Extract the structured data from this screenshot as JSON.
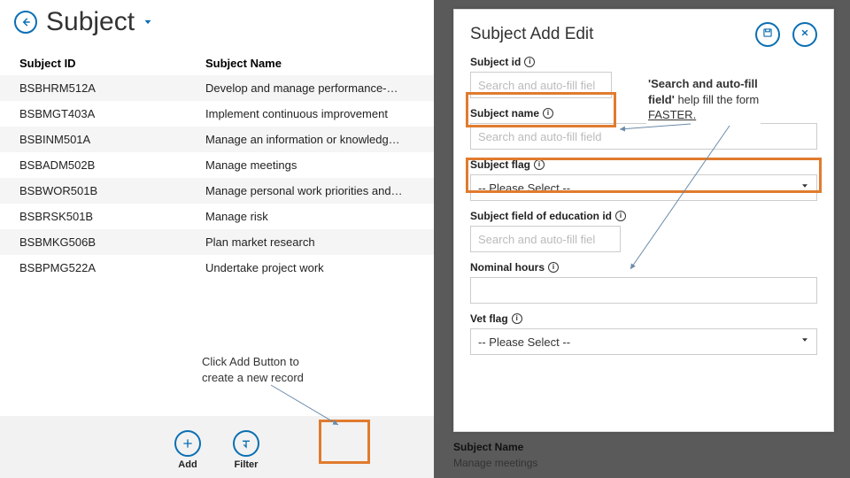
{
  "header": {
    "title": "Subject"
  },
  "table": {
    "col_id": "Subject ID",
    "col_name": "Subject Name",
    "rows": [
      {
        "id": "BSBHRM512A",
        "name": "Develop and manage performance-…"
      },
      {
        "id": "BSBMGT403A",
        "name": "Implement continuous improvement"
      },
      {
        "id": "BSBINM501A",
        "name": "Manage an information or knowledg…"
      },
      {
        "id": "BSBADM502B",
        "name": "Manage meetings"
      },
      {
        "id": "BSBWOR501B",
        "name": "Manage personal work priorities and…"
      },
      {
        "id": "BSBRSK501B",
        "name": "Manage risk"
      },
      {
        "id": "BSBMKG506B",
        "name": "Plan market research"
      },
      {
        "id": "BSBPMG522A",
        "name": "Undertake project work"
      }
    ]
  },
  "footer": {
    "add_label": "Add",
    "filter_label": "Filter"
  },
  "panel": {
    "title": "Subject Add Edit",
    "fields": {
      "subject_id": {
        "label": "Subject id",
        "placeholder": "Search and auto-fill fiel"
      },
      "subject_name": {
        "label": "Subject name",
        "placeholder": "Search and auto-fill field"
      },
      "subject_flag": {
        "label": "Subject flag",
        "selected": "-- Please Select --"
      },
      "foe_id": {
        "label": "Subject field of education id",
        "placeholder": "Search and auto-fill fiel"
      },
      "nominal_hours": {
        "label": "Nominal hours",
        "placeholder": ""
      },
      "vet_flag": {
        "label": "Vet flag",
        "selected": "-- Please Select --"
      }
    }
  },
  "callouts": {
    "left_line1": "Click Add Button to",
    "left_line2": "create a new record",
    "right_bold": "'Search and auto-fill",
    "right_bold2": "field'",
    "right_rest": " help fill the form ",
    "right_underline": "FASTER."
  },
  "dim": {
    "label1": "Subject Name",
    "label2": "Manage meetings"
  },
  "colors": {
    "accent": "#0a6fb3",
    "highlight": "#e07b2e"
  }
}
